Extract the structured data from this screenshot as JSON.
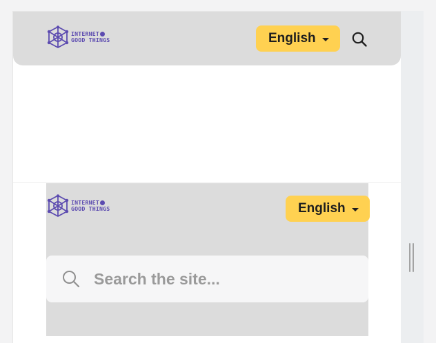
{
  "header": {
    "logo": {
      "line1": "INTERNET",
      "line2": "GOOD THINGS"
    },
    "language": {
      "selected": "English"
    }
  },
  "overlay": {
    "logo": {
      "line1": "INTERNET",
      "line2": "GOOD THINGS"
    },
    "language": {
      "selected": "English"
    },
    "search": {
      "placeholder": "Search the site..."
    }
  },
  "colors": {
    "header_bg": "#dcdcdc",
    "language_button": "#ffd151",
    "logo": "#5c4bb0",
    "search_field": "#f6f6f7"
  },
  "icons": [
    "logo-mark-icon",
    "chevron-down-icon",
    "search-icon"
  ]
}
